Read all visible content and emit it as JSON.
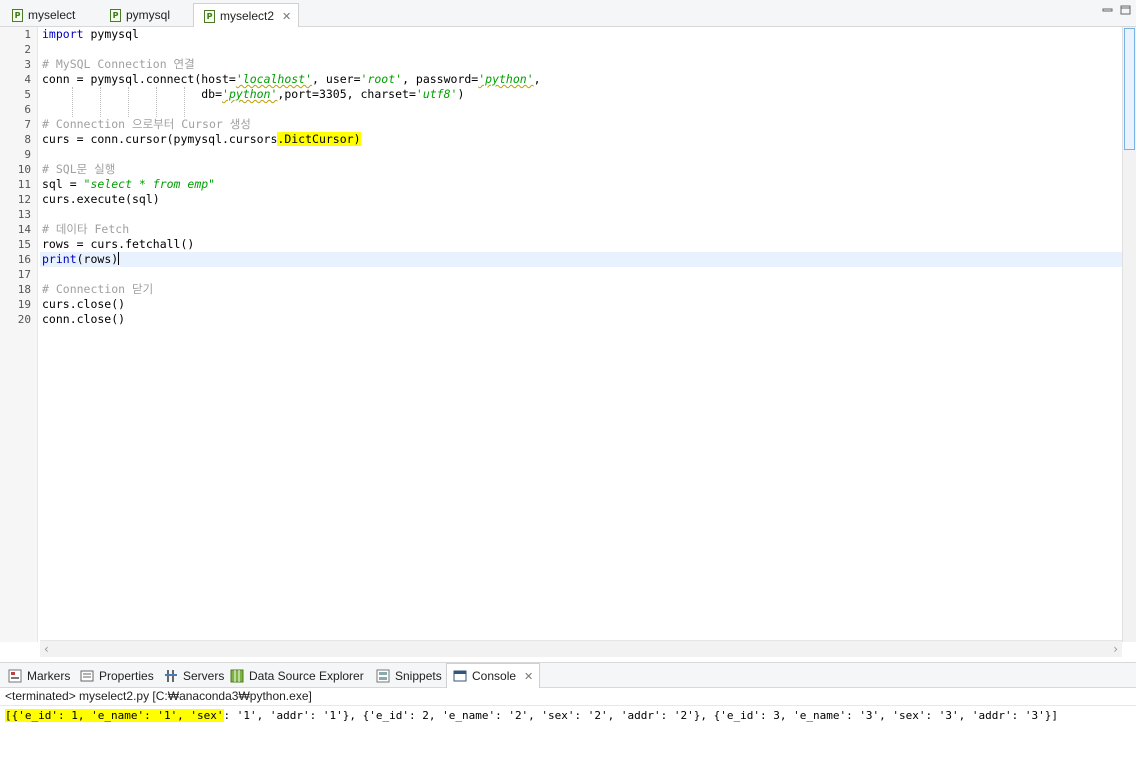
{
  "editor_tabs": [
    {
      "label": "myselect",
      "icon": "python-file-icon",
      "active": false
    },
    {
      "label": "pymysql",
      "icon": "python-file-icon",
      "active": false
    },
    {
      "label": "myselect2",
      "icon": "python-file-icon",
      "active": true
    }
  ],
  "editor": {
    "line_numbers": [
      "1",
      "2",
      "3",
      "4",
      "5",
      "6",
      "7",
      "8",
      "9",
      "10",
      "11",
      "12",
      "13",
      "14",
      "15",
      "16",
      "17",
      "18",
      "19",
      "20"
    ],
    "lines": {
      "l1_kw": "import",
      "l1_rest": " pymysql",
      "l3": "# MySQL Connection 연결",
      "l4_a": "conn = pymysql.connect(host=",
      "l4_b": "'localhost'",
      "l4_c": ", user=",
      "l4_d": "'root'",
      "l4_e": ", password=",
      "l4_f": "'python'",
      "l4_g": ",",
      "l5_a": "                       db=",
      "l5_b": "'python'",
      "l5_c": ",port=3305, charset=",
      "l5_d": "'utf8'",
      "l5_e": ")",
      "l7": "# Connection 으로부터 Cursor 생성",
      "l8_a": "curs = conn.cursor(pymysql.cursors",
      "l8_b": ".DictCursor)",
      "l10": "# SQL문 실행",
      "l11_a": "sql = ",
      "l11_b": "\"select * from emp\"",
      "l12": "curs.execute(sql)",
      "l14": "# 데이타 Fetch",
      "l15": "rows = curs.fetchall()",
      "l16_kw": "print",
      "l16_rest": "(rows)",
      "l18": "# Connection 닫기",
      "l19": "curs.close()",
      "l20": "conn.close()"
    }
  },
  "views": [
    {
      "label": "Markers",
      "icon": "markers-icon"
    },
    {
      "label": "Properties",
      "icon": "properties-icon"
    },
    {
      "label": "Servers",
      "icon": "servers-icon"
    },
    {
      "label": "Data Source Explorer",
      "icon": "data-source-explorer-icon"
    },
    {
      "label": "Snippets",
      "icon": "snippets-icon"
    },
    {
      "label": "Console",
      "icon": "console-icon",
      "active": true
    }
  ],
  "console": {
    "status": "<terminated> myselect2.py [C:₩anaconda3₩python.exe]",
    "output_highlighted": "[{'e_id': 1, 'e_name': '1', 'sex'",
    "output_rest": ": '1', 'addr': '1'}, {'e_id': 2, 'e_name': '2', 'sex': '2', 'addr': '2'}, {'e_id': 3, 'e_name': '3', 'sex': '3', 'addr': '3'}]"
  },
  "colors": {
    "keyword": "#0000c0",
    "comment": "#a0a0a0",
    "string": "#00a000",
    "highlight": "#ffff00",
    "current_line": "#e8f2fe"
  }
}
